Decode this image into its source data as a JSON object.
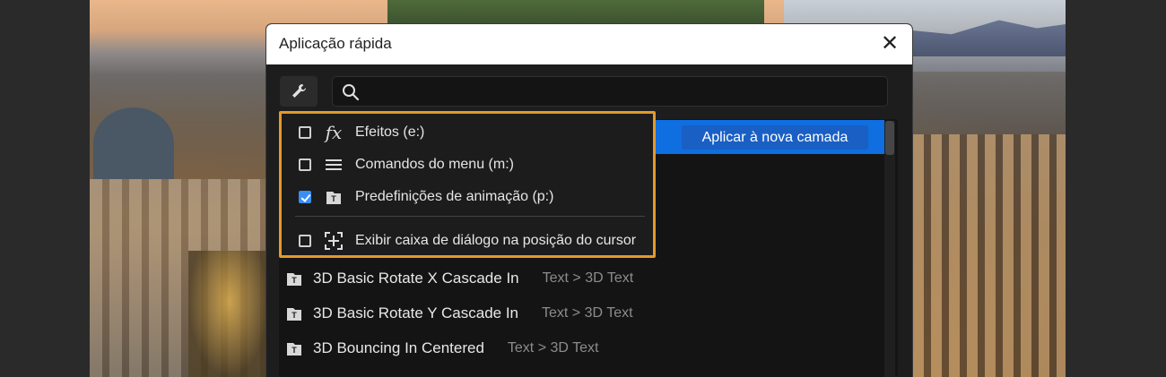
{
  "dialog": {
    "title": "Aplicação rápida",
    "close_label": "✕",
    "search_placeholder": "",
    "apply_button": "Aplicar à nova camada"
  },
  "filter_menu": {
    "options": [
      {
        "label": "Efeitos (e:)",
        "checked": false,
        "icon": "fx-icon"
      },
      {
        "label": "Comandos do menu (m:)",
        "checked": false,
        "icon": "menu-lines-icon"
      },
      {
        "label": "Predefinições de animação (p:)",
        "checked": true,
        "icon": "animation-preset-icon"
      },
      {
        "label": "Exibir caixa de diálogo na posição do cursor",
        "checked": false,
        "icon": "cursor-position-icon"
      }
    ]
  },
  "results": [
    {
      "name": "3D Basic Rotate X Cascade In",
      "path": "Text > 3D Text"
    },
    {
      "name": "3D Basic Rotate Y Cascade In",
      "path": "Text > 3D Text"
    },
    {
      "name": "3D Bouncing In Centered",
      "path": "Text > 3D Text"
    }
  ],
  "colors": {
    "accent": "#0f6ee0",
    "highlight_border": "#e39a2a",
    "checkbox_checked": "#3a8ef5"
  }
}
